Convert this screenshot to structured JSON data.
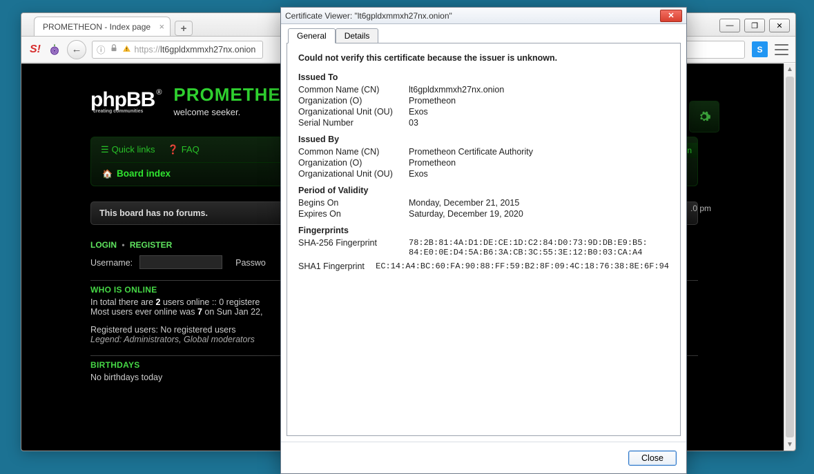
{
  "browser": {
    "tab_title": "PROMETHEON - Index page",
    "url_scheme": "https://",
    "url_host": "lt6gpldxmmxh27nx.onion",
    "skype_badge": "S"
  },
  "win_controls": {
    "min": "—",
    "max": "❐",
    "close": "✕"
  },
  "forum": {
    "logo_text": "phpBB",
    "logo_reg": "®",
    "logo_sub": "creating communities",
    "site_title": "PROMETHEON",
    "welcome": "welcome seeker.",
    "quick_links": "Quick links",
    "faq": "FAQ",
    "ogin_label": "ogin",
    "board_index": "Board index",
    "time_tail": ".0 pm",
    "no_forums": "This board has no forums.",
    "login_label": "LOGIN",
    "register_label": "REGISTER",
    "username_label": "Username:",
    "password_label": "Passwo",
    "who_heading": "WHO IS ONLINE",
    "who_line1_a": "In total there are ",
    "who_line1_b": "2",
    "who_line1_c": " users online :: 0 registere",
    "who_line2_a": "Most users ever online was ",
    "who_line2_b": "7",
    "who_line2_c": " on Sun Jan 22, ",
    "reg_users": "Registered users: No registered users",
    "legend_label": "Legend: ",
    "admins": "Administrators",
    "comma": ", ",
    "gmods": "Global moderators",
    "bday_heading": "BIRTHDAYS",
    "bday_text": "No birthdays today"
  },
  "cert": {
    "title": "Certificate Viewer: \"lt6gpldxmmxh27nx.onion\"",
    "tab_general": "General",
    "tab_details": "Details",
    "error": "Could not verify this certificate because the issuer is unknown.",
    "issued_to_h": "Issued To",
    "issued_by_h": "Issued By",
    "validity_h": "Period of Validity",
    "fp_h": "Fingerprints",
    "labels": {
      "cn": "Common Name (CN)",
      "o": "Organization (O)",
      "ou": "Organizational Unit (OU)",
      "sn": "Serial Number",
      "begins": "Begins On",
      "expires": "Expires On",
      "sha256": "SHA-256 Fingerprint",
      "sha1": "SHA1 Fingerprint"
    },
    "issued_to": {
      "cn": "lt6gpldxmmxh27nx.onion",
      "o": "Prometheon",
      "ou": "Exos",
      "sn": "03"
    },
    "issued_by": {
      "cn": "Prometheon Certificate Authority",
      "o": "Prometheon",
      "ou": "Exos"
    },
    "validity": {
      "begins": "Monday, December 21, 2015",
      "expires": "Saturday, December 19, 2020"
    },
    "fingerprints": {
      "sha256_l1": "78:2B:81:4A:D1:DE:CE:1D:C2:84:D0:73:9D:DB:E9:B5:",
      "sha256_l2": "84:E0:0E:D4:5A:B6:3A:CB:3C:55:3E:12:B0:03:CA:A4",
      "sha1": "EC:14:A4:BC:60:FA:90:88:FF:59:B2:8F:09:4C:18:76:38:8E:6F:94"
    },
    "close": "Close"
  }
}
